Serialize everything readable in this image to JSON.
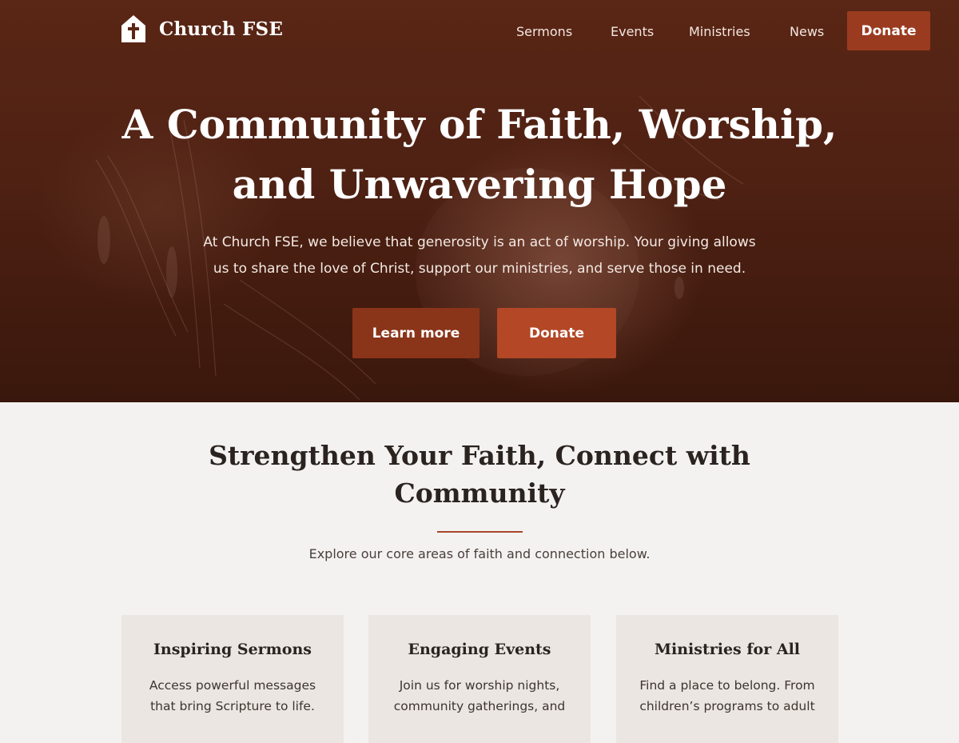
{
  "brand": {
    "name": "Church FSE",
    "icon": "church-cross-icon"
  },
  "nav": {
    "links": [
      "Sermons",
      "Events",
      "Ministries",
      "News"
    ],
    "donate_label": "Donate"
  },
  "hero": {
    "title_line1": "A Community of Faith, Worship,",
    "title_line2": "and Unwavering Hope",
    "text_line1": "At Church FSE, we believe that generosity is an act of worship. Your giving allows",
    "text_line2": "us to share the love of Christ, support our ministries, and serve those in need.",
    "learn_more_label": "Learn more",
    "donate_label": "Donate"
  },
  "section": {
    "title_line1": "Strengthen Your Faith, Connect with",
    "title_line2": "Community",
    "subtitle": "Explore our core areas of faith and connection below.",
    "cards": [
      {
        "title": "Inspiring Sermons",
        "line1": "Access powerful messages",
        "line2": "that bring Scripture to life."
      },
      {
        "title": "Engaging Events",
        "line1": "Join us for worship nights,",
        "line2": "community gatherings, and"
      },
      {
        "title": "Ministries for All",
        "line1": "Find a place to belong. From",
        "line2": "children’s programs to adult"
      }
    ]
  },
  "colors": {
    "hero_dark": "#4e2113",
    "accent": "#b34726",
    "accent_dark": "#8a3419",
    "page_bg": "#f4f2f0",
    "card_bg": "#ebe6e1"
  }
}
